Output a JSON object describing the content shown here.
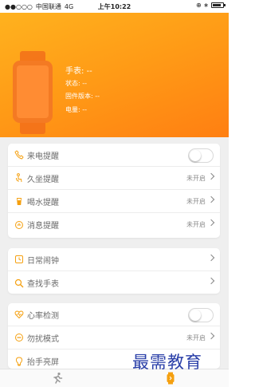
{
  "status_bar": {
    "signal": "●●○○○",
    "carrier": "中国联通",
    "network": "4G",
    "time": "上午10:22",
    "right_icons": "⊕ ∗",
    "battery_level": 0.85
  },
  "hero": {
    "title": "手表: --",
    "status": "状态: --",
    "firmware": "固件版本: --",
    "battery": "电量: --"
  },
  "group1": [
    {
      "icon": "phone-icon",
      "label": "来电提醒",
      "control": "toggle",
      "on": false
    },
    {
      "icon": "sit-icon",
      "label": "久坐提醒",
      "value": "未开启"
    },
    {
      "icon": "cup-icon",
      "label": "喝水提醒",
      "value": "未开启"
    },
    {
      "icon": "message-icon",
      "label": "消息提醒",
      "value": "未开启"
    }
  ],
  "group2": [
    {
      "icon": "alarm-icon",
      "label": "日常闹钟"
    },
    {
      "icon": "search-icon",
      "label": "查找手表"
    }
  ],
  "group3": [
    {
      "icon": "heart-icon",
      "label": "心率检测",
      "control": "toggle",
      "on": false
    },
    {
      "icon": "dnd-icon",
      "label": "勿扰模式",
      "value": "未开启"
    },
    {
      "icon": "bulb-icon",
      "label": "抬手亮屏"
    }
  ],
  "watermark": "最需教育",
  "colors": {
    "accent": "#f5a010",
    "hero_start": "#ffb21e",
    "hero_end": "#ff7f12"
  }
}
